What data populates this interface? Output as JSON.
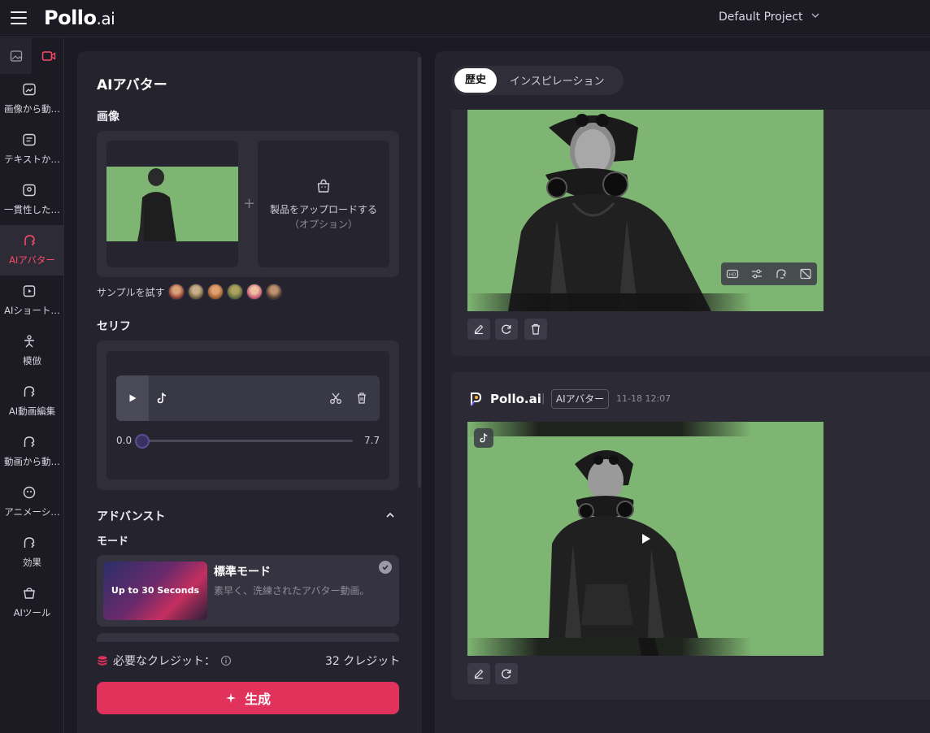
{
  "header": {
    "logo_main": "Pollo",
    "logo_suffix": ".ai",
    "project_name": "Default Project"
  },
  "sidebar": {
    "items": [
      {
        "label": "画像から動…",
        "icon": "image-to-video-icon"
      },
      {
        "label": "テキストか…",
        "icon": "text-to-video-icon"
      },
      {
        "label": "一貫性した…",
        "icon": "consistent-character-icon"
      },
      {
        "label": "AIアバター",
        "icon": "ai-avatar-icon",
        "active": true
      },
      {
        "label": "AIショート…",
        "icon": "ai-short-icon"
      },
      {
        "label": "模倣",
        "icon": "imitate-icon"
      },
      {
        "label": "AI動画編集",
        "icon": "ai-video-edit-icon"
      },
      {
        "label": "動画から動…",
        "icon": "video-to-video-icon"
      },
      {
        "label": "アニメーシ…",
        "icon": "animation-icon"
      },
      {
        "label": "効果",
        "icon": "effects-icon"
      },
      {
        "label": "AIツール",
        "icon": "ai-tools-icon"
      }
    ]
  },
  "left": {
    "title": "AIアバター",
    "image_label": "画像",
    "upload_line1": "製品をアップロードする",
    "upload_line2": "（オプション）",
    "samples_label": "サンプルを試す",
    "serif_label": "セリフ",
    "time_start": "0.0",
    "time_end": "7.7",
    "audio_progress": 0.0,
    "advanced_label": "アドバンスト",
    "mode_label": "モード",
    "mode_thumb_text": "Up to 30 Seconds",
    "mode_title": "標準モード",
    "mode_desc": "素早く、洗練されたアバター動画。",
    "credits_label": "必要なクレジット：",
    "credits_value": "32 クレジット",
    "generate_label": "生成"
  },
  "right": {
    "tab_history": "歴史",
    "tab_inspiration": "インスピレーション",
    "brand_name": "Pollo.ai",
    "tag": "AIアバター",
    "timestamp": "11-18 12:07"
  },
  "colors": {
    "accent": "#e0325a",
    "active_sidebar": "#ff4a6c",
    "video_bg": "#7fb572"
  }
}
